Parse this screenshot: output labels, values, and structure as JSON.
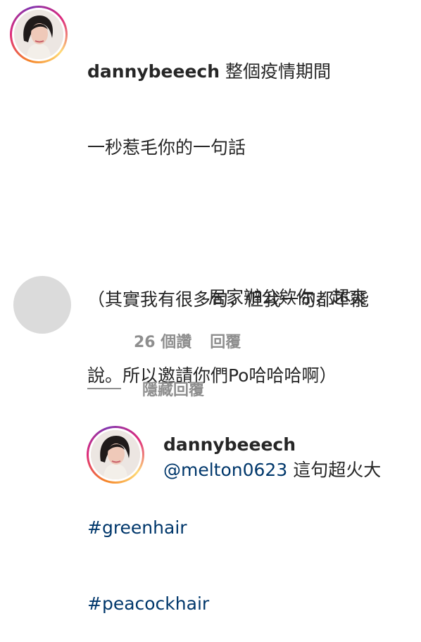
{
  "post": {
    "username": "dannybeeech",
    "caption_lines": [
      "整個疫情期間",
      "一秒惹毛你的一句話",
      "",
      "（其實我有很多句，但我一句都不能",
      "說。所以邀請你們Po哈哈哈啊）",
      ""
    ],
    "hashtags": [
      "#greenhair",
      "#peacockhair"
    ],
    "avatar_icon": "profile-photo-icon"
  },
  "comment": {
    "text": "居家辦公欸你，超爽",
    "likes": "26 個讚",
    "reply_label": "回覆",
    "hide_replies_label": "隱藏回覆",
    "avatar_icon": "placeholder-avatar"
  },
  "reply": {
    "username": "dannybeeech",
    "mention": "@melton0623",
    "text": " 這句超火大"
  },
  "colors": {
    "text": "#262626",
    "link": "#00376b",
    "muted": "#8e8e8e",
    "placeholder": "#dbdbdb"
  }
}
